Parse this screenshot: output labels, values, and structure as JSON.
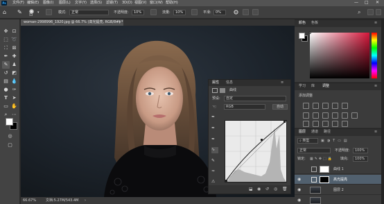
{
  "menubar": {
    "app_icon": "Ps",
    "items": [
      "文件(F)",
      "编辑(E)",
      "图像(I)",
      "图层(L)",
      "文字(Y)",
      "选择(S)",
      "滤镜(T)",
      "3D(D)",
      "视图(V)",
      "窗口(W)",
      "帮助(H)"
    ],
    "window_controls": [
      "—",
      "□",
      "✕"
    ]
  },
  "options": {
    "brush_size": "53",
    "mode_label": "模式:",
    "mode_value": "正常",
    "opacity_label": "不透明度:",
    "opacity_value": "10%",
    "flow_label": "流量:",
    "flow_value": "10%",
    "smooth_label": "平滑:",
    "smooth_value": "0%"
  },
  "document": {
    "tab_title": "woman-2998996_1920.jpg @ 66.7% (高光提亮, RGB/8#) *",
    "tab_close": "×",
    "status_zoom": "66.67%",
    "status_info": "文档:5.27M/543.4M"
  },
  "properties": {
    "tabs": [
      "属性",
      "信息"
    ],
    "adjustment_name": "曲线",
    "preset_label": "预设:",
    "preset_value": "自定",
    "channel_value": "RGB",
    "auto_button": "自动"
  },
  "color_panel": {
    "tabs": [
      "颜色",
      "色板"
    ],
    "hue_color": "#d6163a"
  },
  "adjustments_panel": {
    "tabs": [
      "学习",
      "库",
      "调整"
    ],
    "add_label": "添加调整"
  },
  "layers_panel": {
    "tabs": [
      "图层",
      "通道",
      "路径"
    ],
    "filter_label": "类型",
    "blend_mode": "正常",
    "opacity_label": "不透明度:",
    "opacity_value": "100%",
    "lock_label": "锁定:",
    "fill_label": "填充:",
    "fill_value": "100%",
    "layers": [
      {
        "name": "曲线 1",
        "visible": false,
        "selected": false
      },
      {
        "name": "高光提亮",
        "visible": true,
        "selected": true
      },
      {
        "name": "图层 2",
        "visible": true,
        "selected": false
      },
      {
        "name": "",
        "visible": true,
        "selected": false
      }
    ]
  },
  "colors": {
    "menubar_bg": "#535353",
    "panel_bg": "#3b3b3b",
    "canvas_bg": "#1c232b",
    "accent_selected": "#51606e"
  }
}
